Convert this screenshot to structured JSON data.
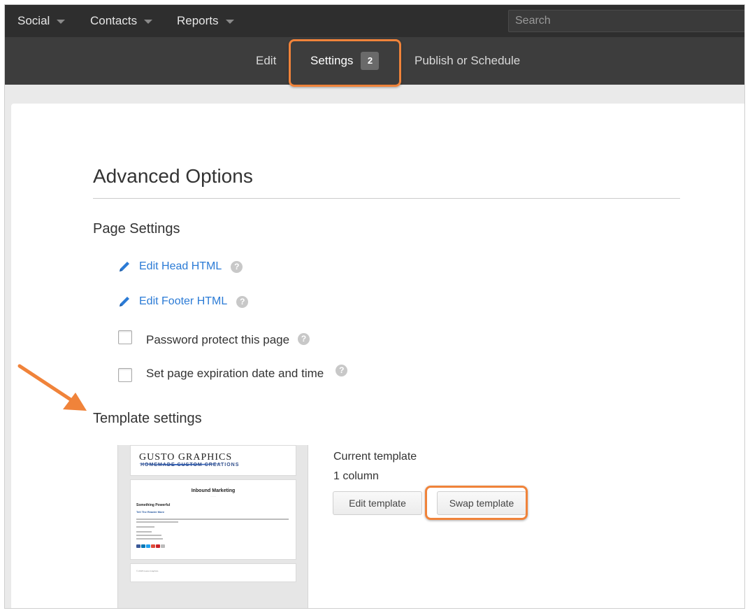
{
  "topnav": {
    "menus": [
      {
        "label": "Social"
      },
      {
        "label": "Contacts"
      },
      {
        "label": "Reports"
      }
    ],
    "search_placeholder": "Search"
  },
  "subnav": {
    "tabs": [
      {
        "label": "Edit",
        "active": false
      },
      {
        "label": "Settings",
        "badge": "2",
        "active": true
      },
      {
        "label": "Publish or Schedule",
        "active": false
      }
    ]
  },
  "page": {
    "title": "Advanced Options",
    "page_settings": {
      "heading": "Page Settings",
      "links": [
        {
          "label": "Edit Head HTML",
          "icon": "pencil-icon",
          "help": "?"
        },
        {
          "label": "Edit Footer HTML",
          "icon": "pencil-icon",
          "help": "?"
        }
      ],
      "checkboxes": [
        {
          "label": "Password protect this page",
          "checked": false,
          "help": "?"
        },
        {
          "label": "Set page expiration date and time",
          "checked": false,
          "help": "?"
        }
      ]
    },
    "template_settings": {
      "heading": "Template settings",
      "current_template_label": "Current template",
      "layout": "1 column",
      "edit_button": "Edit template",
      "swap_button": "Swap template",
      "thumbnail": {
        "logo_title": "GUSTO GRAPHICS",
        "logo_tagline": "HOMEMADE CUSTOM CREATIONS",
        "headline": "Inbound Marketing",
        "subhead": "Something Powerful",
        "subhead2": "Tell The Reader More",
        "footer": "© 2015 Gusto Graphics"
      }
    }
  },
  "colors": {
    "highlight": "#f0833a",
    "link": "#2b7bd6",
    "nav_dark": "#2e2e2e",
    "subnav": "#3d3d3d"
  }
}
